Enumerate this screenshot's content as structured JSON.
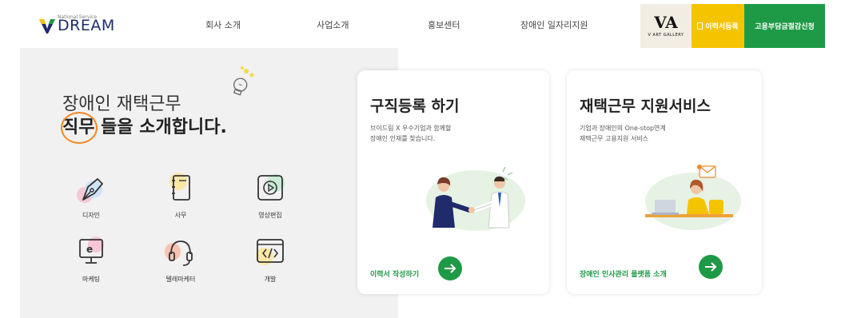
{
  "header": {
    "logo_text": "DREAM",
    "logo_small": "National Service",
    "nav": [
      "회사 소개",
      "사업소개",
      "홍보센터",
      "장애인 일자리지원"
    ],
    "va_logo": "VA",
    "va_sub": "V ART GALLERY",
    "resume_button": "이력서등록",
    "subsidy_button": "고용부담금절감신청",
    "colors": {
      "resume": "#f5c400",
      "subsidy": "#1e9a47",
      "accent": "#f08a24"
    }
  },
  "intro": {
    "line1": "장애인 재택근무",
    "line2": "직무 들을 소개합니다.",
    "jobs": [
      {
        "label": "디자인",
        "icon": "pen-nib-icon"
      },
      {
        "label": "사무",
        "icon": "notebook-icon"
      },
      {
        "label": "영상편집",
        "icon": "play-video-icon"
      },
      {
        "label": "마케팅",
        "icon": "monitor-e-icon"
      },
      {
        "label": "텔레마케터",
        "icon": "headset-icon"
      },
      {
        "label": "개발",
        "icon": "code-window-icon"
      }
    ]
  },
  "cards": [
    {
      "title": "구직등록 하기",
      "desc1": "브이드림 X 우수기업과 함께할",
      "desc2": "장애인 인재를 찾습니다.",
      "link": "이력서 작성하기"
    },
    {
      "title": "재택근무 지원서비스",
      "desc1": "기업과 장애인의 One-stop연계",
      "desc2": "재택근무 고용지원 서비스",
      "link": "장애인 인사관리 플랫폼 소개"
    }
  ]
}
